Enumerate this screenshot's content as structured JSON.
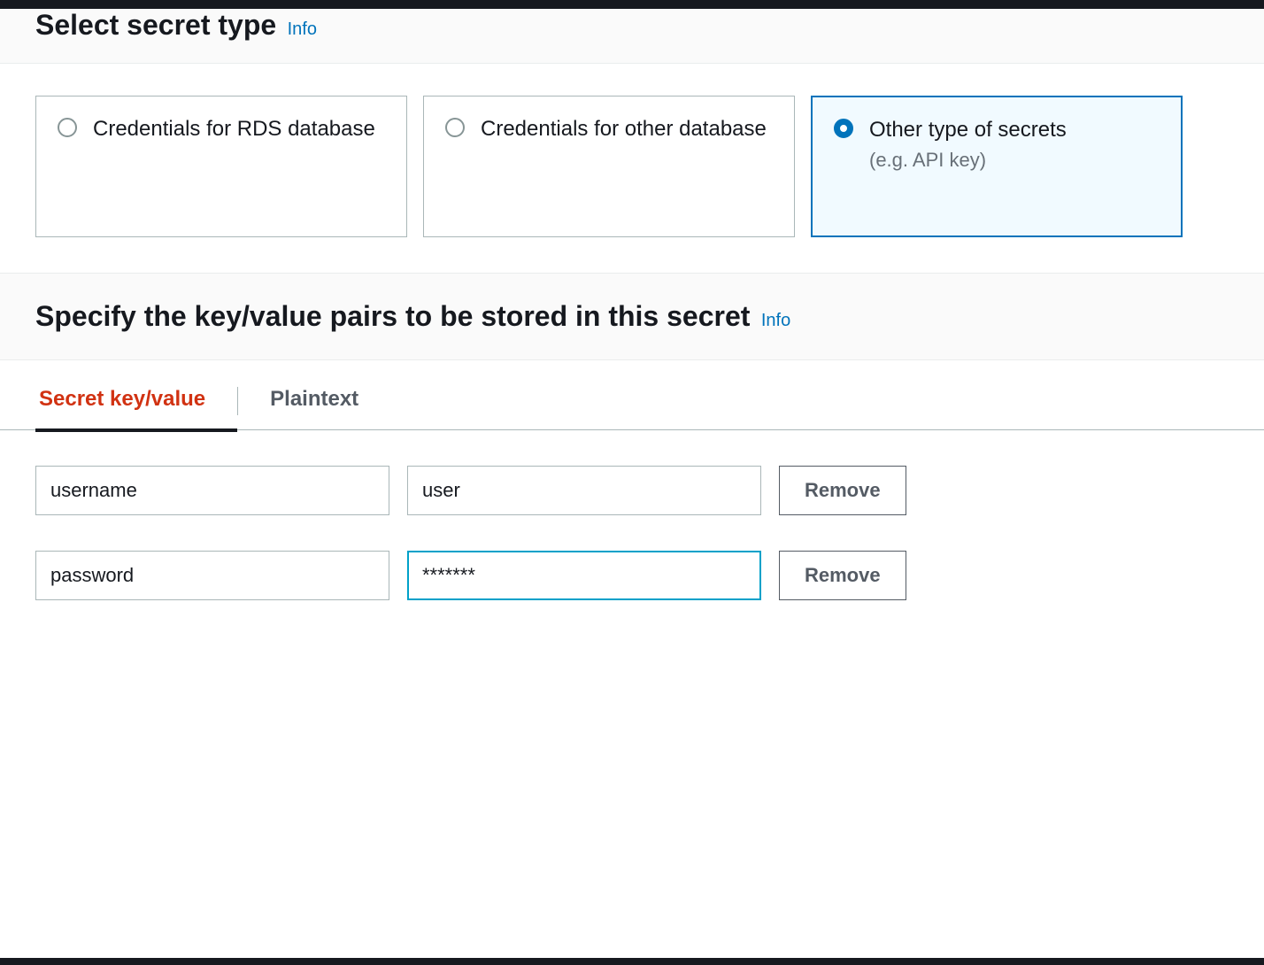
{
  "section1": {
    "title": "Select secret type",
    "info": "Info"
  },
  "options": [
    {
      "label": "Credentials for RDS database",
      "sublabel": "",
      "selected": false
    },
    {
      "label": "Credentials for other database",
      "sublabel": "",
      "selected": false
    },
    {
      "label": "Other type of secrets",
      "sublabel": "(e.g. API key)",
      "selected": true
    }
  ],
  "section2": {
    "title": "Specify the key/value pairs to be stored in this secret",
    "info": "Info"
  },
  "tabs": [
    {
      "label": "Secret key/value",
      "active": true
    },
    {
      "label": "Plaintext",
      "active": false
    }
  ],
  "kv_pairs": [
    {
      "key": "username",
      "value": "user",
      "focused": false
    },
    {
      "key": "password",
      "value": "*******",
      "focused": true
    }
  ],
  "buttons": {
    "remove": "Remove"
  }
}
